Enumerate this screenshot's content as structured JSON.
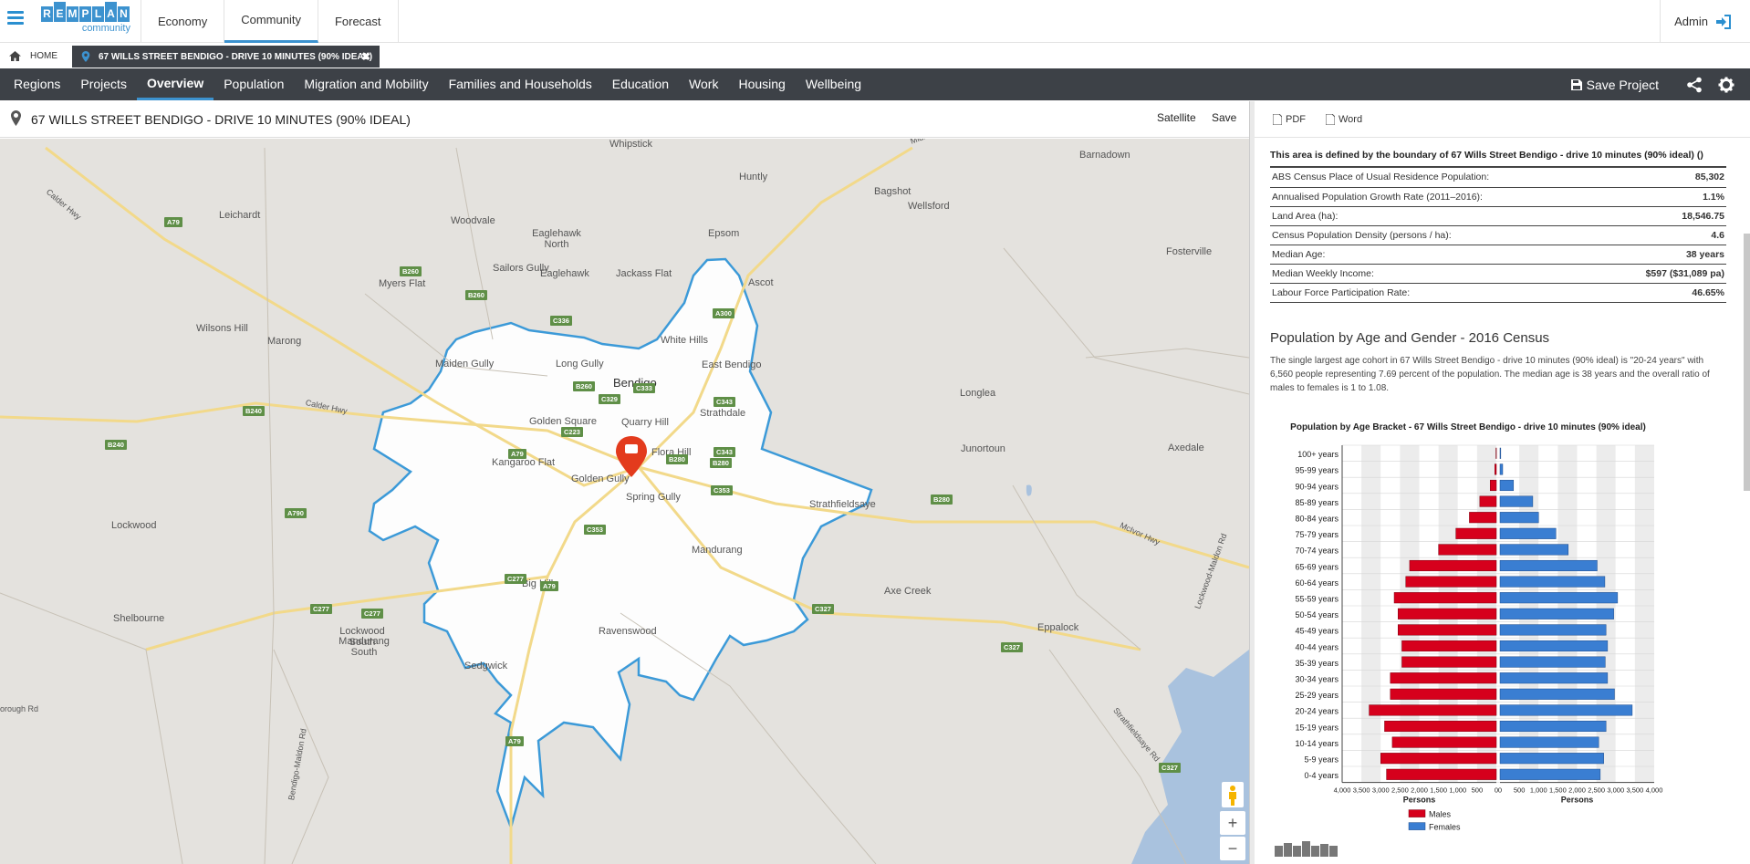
{
  "topnav": {
    "logo_text": "REMPLAN",
    "logo_sub": "community",
    "items": [
      {
        "label": "Economy",
        "active": false
      },
      {
        "label": "Community",
        "active": true
      },
      {
        "label": "Forecast",
        "active": false
      }
    ],
    "admin_label": "Admin"
  },
  "tabs": {
    "home_label": "HOME",
    "project_label": "67 WILLS STREET BENDIGO - DRIVE 10 MINUTES (90% IDEAL)"
  },
  "mainnav": {
    "items": [
      {
        "label": "Regions",
        "active": false
      },
      {
        "label": "Projects",
        "active": false
      },
      {
        "label": "Overview",
        "active": true
      },
      {
        "label": "Population",
        "active": false
      },
      {
        "label": "Migration and Mobility",
        "active": false
      },
      {
        "label": "Families and Households",
        "active": false
      },
      {
        "label": "Education",
        "active": false
      },
      {
        "label": "Work",
        "active": false
      },
      {
        "label": "Housing",
        "active": false
      },
      {
        "label": "Wellbeing",
        "active": false
      }
    ],
    "save_project_label": "Save Project"
  },
  "map": {
    "title": "67 WILLS STREET BENDIGO - DRIVE 10 MINUTES (90% IDEAL)",
    "satellite_label": "Satellite",
    "save_label": "Save",
    "places": [
      "Whipstick",
      "Huntly",
      "Barnadown",
      "Woodvale",
      "Bagshot",
      "Leichardt",
      "Eaglehawk North",
      "Wellsford",
      "Sailors Gully",
      "Epsom",
      "Fosterville",
      "Myers Flat",
      "Eaglehawk",
      "Jackass Flat",
      "Ascot",
      "Wilsons Hill",
      "Marong",
      "White Hills",
      "Maiden Gully",
      "Long Gully",
      "East Bendigo",
      "Bendigo",
      "Longlea",
      "Golden Square",
      "Quarry Hill",
      "Strathdale",
      "Junortoun",
      "Axedale",
      "Flora Hill",
      "Kangaroo Flat",
      "Golden Gully",
      "Spring Gully",
      "Strathfieldsaye",
      "Lockwood",
      "Mandurang",
      "Shelbourne",
      "Big Hill",
      "Axe Creek",
      "Lockwood South",
      "Eppalock",
      "Mandurang South",
      "Ravenswood",
      "Sedgwick"
    ],
    "road_signs": [
      "B260",
      "A79",
      "B260",
      "C336",
      "A300",
      "B260",
      "C329",
      "C333",
      "C343",
      "B240",
      "C223",
      "A79",
      "B280",
      "C343",
      "B280",
      "C353",
      "B240",
      "A790",
      "C353",
      "B280",
      "C277",
      "A79",
      "C277",
      "C327",
      "C277",
      "C327",
      "A79",
      "C327"
    ],
    "road_names": [
      "Calder Hwy",
      "Midland Hwy",
      "Calder Hwy",
      "McIvor Hwy",
      "Strathfieldsaye Rd",
      "Lockwood-Maldon Rd",
      "Bendigo-Maldon Rd",
      "borough Rd"
    ]
  },
  "panel": {
    "pdf_label": "PDF",
    "word_label": "Word",
    "definition": "This area is defined by the boundary of 67 Wills Street Bendigo - drive 10 minutes (90% ideal) ()",
    "stats": [
      {
        "label": "ABS Census Place of Usual Residence Population:",
        "value": "85,302"
      },
      {
        "label": "Annualised Population Growth Rate (2011–2016):",
        "value": "1.1%"
      },
      {
        "label": "Land Area (ha):",
        "value": "18,546.75"
      },
      {
        "label": "Census Population Density (persons / ha):",
        "value": "4.6"
      },
      {
        "label": "Median Age:",
        "value": "38 years"
      },
      {
        "label": "Median Weekly Income:",
        "value": "$597 ($31,089 pa)"
      },
      {
        "label": "Labour Force Participation Rate:",
        "value": "46.65%"
      }
    ],
    "chart_heading": "Population by Age and Gender - 2016 Census",
    "chart_description": "The single largest age cohort in 67 Wills Street Bendigo - drive 10 minutes (90% ideal) is \"20-24 years\" with 6,560 people representing 7.69 percent of the population. The median age is 38 years and the overall ratio of males to females is 1 to 1.08.",
    "footer_logo": "REMPLAN"
  },
  "chart_data": {
    "type": "bar",
    "title": "Population by Age Bracket - 67 Wills Street Bendigo - drive 10 minutes (90% ideal)",
    "categories": [
      "100+ years",
      "95-99 years",
      "90-94 years",
      "85-89 years",
      "80-84 years",
      "75-79 years",
      "70-74 years",
      "65-69 years",
      "60-64 years",
      "55-59 years",
      "50-54 years",
      "45-49 years",
      "40-44 years",
      "35-39 years",
      "30-34 years",
      "25-29 years",
      "20-24 years",
      "15-19 years",
      "10-14 years",
      "5-9 years",
      "0-4 years"
    ],
    "series": [
      {
        "name": "Males",
        "color": "#d6001c",
        "values": [
          10,
          40,
          160,
          430,
          700,
          1050,
          1500,
          2250,
          2350,
          2650,
          2550,
          2550,
          2450,
          2450,
          2750,
          2750,
          3300,
          2900,
          2700,
          3000,
          2850
        ]
      },
      {
        "name": "Females",
        "color": "#3a7ed2",
        "values": [
          20,
          70,
          350,
          850,
          1000,
          1450,
          1770,
          2520,
          2720,
          3050,
          2950,
          2750,
          2790,
          2730,
          2790,
          2970,
          3430,
          2750,
          2560,
          2690,
          2600
        ]
      }
    ],
    "xlim": [
      0,
      4000
    ],
    "male_ticks": [
      "4,000",
      "3,500",
      "3,000",
      "2,500",
      "2,000",
      "1,500",
      "1,000",
      "500",
      "0"
    ],
    "female_ticks": [
      "0",
      "500",
      "1,000",
      "1,500",
      "2,000",
      "2,500",
      "3,000",
      "3,500",
      "4,000"
    ],
    "xlabel": "Persons",
    "legend": "bottom-center"
  }
}
